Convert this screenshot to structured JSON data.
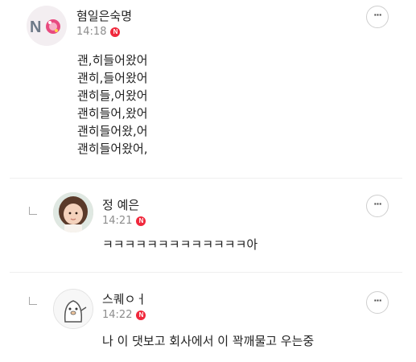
{
  "comments": [
    {
      "author": "혐일은숙명",
      "time": "14:18",
      "badge": "N",
      "lines": [
        "괜,히들어왔어",
        "괜히,들어왔어",
        "괜히들,어왔어",
        "괜히들어,왔어",
        "괜히들어왔,어",
        "괜히들어왔어,"
      ],
      "avatar_icon": "no-logo-avatar-icon"
    },
    {
      "author": "정 예은",
      "time": "14:21",
      "badge": "N",
      "lines": [
        "ㅋㅋㅋㅋㅋㅋㅋㅋㅋㅋㅋㅋㅋ아"
      ],
      "is_reply": true,
      "avatar_icon": "child-photo-avatar-icon"
    },
    {
      "author": "스퀘ㅇㅓ",
      "time": "14:22",
      "badge": "N",
      "lines": [
        "나 이 댓보고 회사에서 이 꽉깨물고 우는중"
      ],
      "is_reply": true,
      "avatar_icon": "cartoon-character-avatar-icon"
    }
  ],
  "more_button_label": "···",
  "colors": {
    "badge": "#f0283c",
    "time": "#8d8d8d",
    "divider": "#efefef"
  }
}
